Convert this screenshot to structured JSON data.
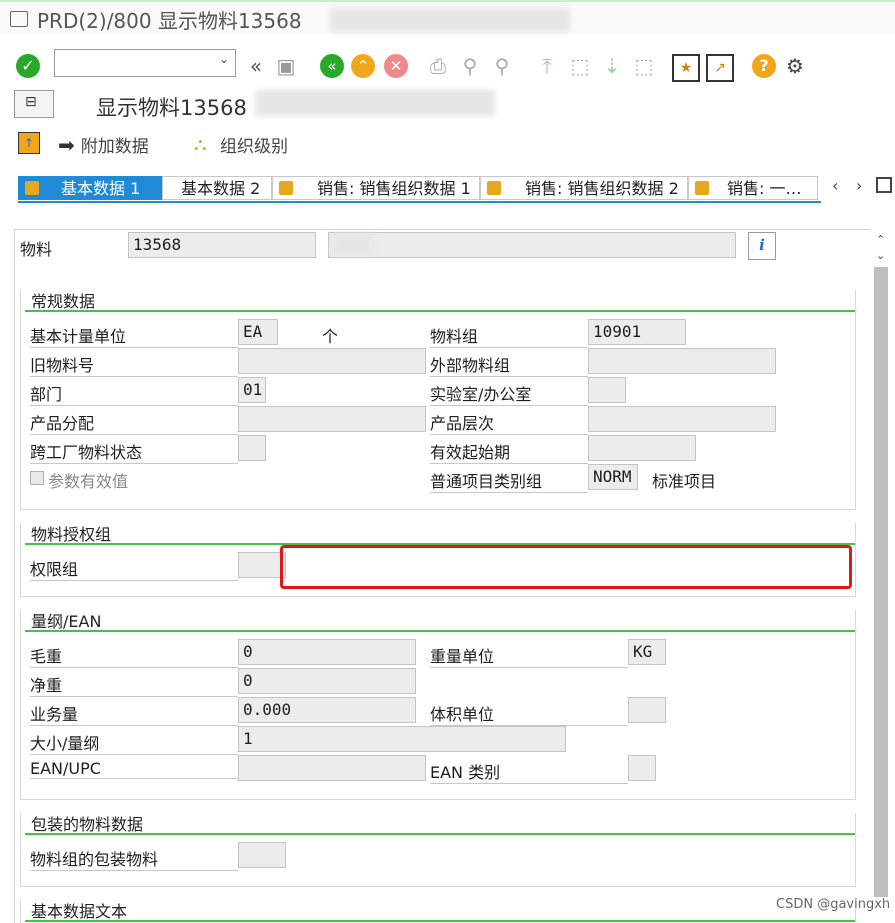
{
  "window": {
    "title": "PRD(2)/800 显示物料13568"
  },
  "toolbar": {
    "command_value": "",
    "command_placeholder": ""
  },
  "app": {
    "title": "显示物料13568"
  },
  "app_toolbar": {
    "additional_data": "附加数据",
    "org_levels": "组织级别"
  },
  "tabs": [
    {
      "label": "基本数据 1"
    },
    {
      "label": "基本数据 2"
    },
    {
      "label": "销售: 销售组织数据 1"
    },
    {
      "label": "销售: 销售组织数据 2"
    },
    {
      "label": "销售: 一…"
    }
  ],
  "header": {
    "material_label": "物料",
    "material_value": "13568",
    "info_icon": "i"
  },
  "general": {
    "title": "常规数据",
    "base_uom_label": "基本计量单位",
    "base_uom_value": "EA",
    "base_uom_text": "个",
    "mat_group_label": "物料组",
    "mat_group_value": "10901",
    "old_mat_label": "旧物料号",
    "old_mat_value": "",
    "ext_group_label": "外部物料组",
    "ext_group_value": "",
    "division_label": "部门",
    "division_value": "01",
    "lab_label": "实验室/办公室",
    "lab_value": "",
    "product_alloc_label": "产品分配",
    "product_alloc_value": "",
    "product_hier_label": "产品层次",
    "product_hier_value": "",
    "xplant_status_label": "跨工厂物料状态",
    "xplant_status_value": "",
    "valid_from_label": "有效起始期",
    "valid_from_value": "",
    "param_eff_label": "参数有效值",
    "item_cat_label": "普通项目类别组",
    "item_cat_value": "NORM",
    "item_cat_text": "标准项目"
  },
  "auth": {
    "title": "物料授权组",
    "group_label": "权限组",
    "group_value": ""
  },
  "dims": {
    "title": "量纲/EAN",
    "gross_label": "毛重",
    "gross_value": "0",
    "weight_unit_label": "重量单位",
    "weight_unit_value": "KG",
    "net_label": "净重",
    "net_value": "0",
    "volume_label": "业务量",
    "volume_value": "0.000",
    "volume_unit_label": "体积单位",
    "volume_unit_value": "",
    "size_label": "大小/量纲",
    "size_value": "1",
    "ean_label": "EAN/UPC",
    "ean_value": "",
    "ean_cat_label": "EAN 类别",
    "ean_cat_value": ""
  },
  "packaging": {
    "title": "包装的物料数据",
    "group_label": "物料组的包装物料",
    "group_value": ""
  },
  "basic_text": {
    "title": "基本数据文本"
  },
  "watermark": "CSDN @gavingxh",
  "colors": {
    "accent_tab": "#1f8bd6",
    "group_line": "#47c247",
    "highlight": "#e01818"
  }
}
